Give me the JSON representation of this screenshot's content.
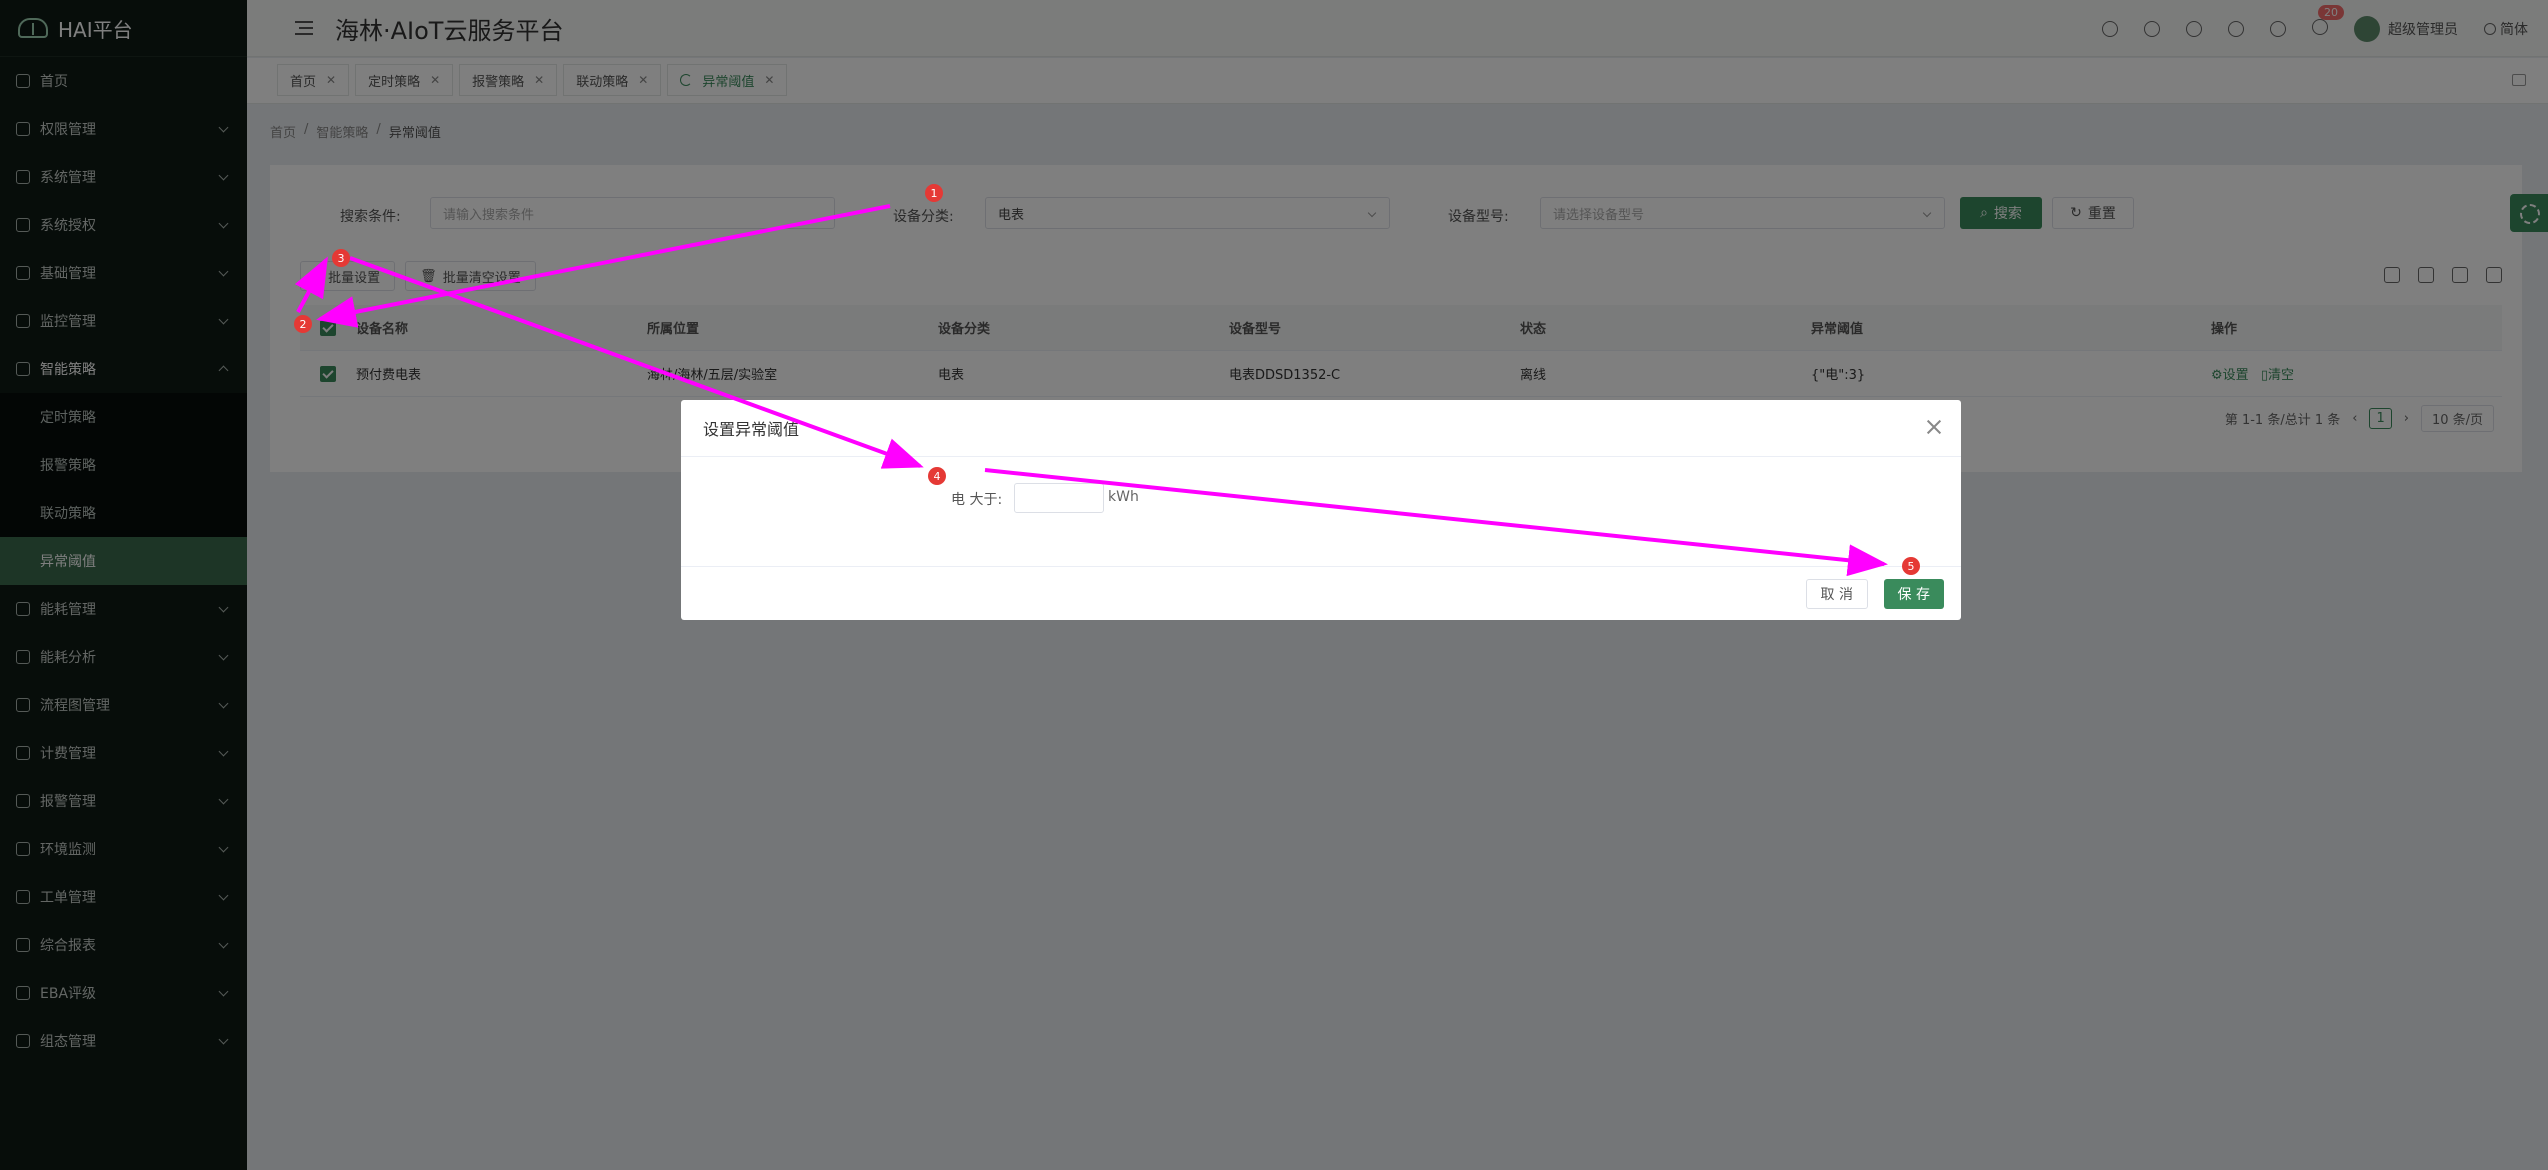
{
  "sidebar": {
    "logo": "HAI平台",
    "items": [
      {
        "label": "首页"
      },
      {
        "label": "权限管理"
      },
      {
        "label": "系统管理"
      },
      {
        "label": "系统授权"
      },
      {
        "label": "基础管理"
      },
      {
        "label": "监控管理"
      },
      {
        "label": "智能策略"
      },
      {
        "label": "能耗管理"
      },
      {
        "label": "能耗分析"
      },
      {
        "label": "流程图管理"
      },
      {
        "label": "计费管理"
      },
      {
        "label": "报警管理"
      },
      {
        "label": "环境监测"
      },
      {
        "label": "工单管理"
      },
      {
        "label": "综合报表"
      },
      {
        "label": "EBA评级"
      },
      {
        "label": "组态管理"
      }
    ],
    "subitems": [
      {
        "label": "定时策略"
      },
      {
        "label": "报警策略"
      },
      {
        "label": "联动策略"
      },
      {
        "label": "异常阈值"
      }
    ]
  },
  "header": {
    "title": "海林·AIoT云服务平台",
    "notify_count": "20",
    "user": "超级管理员",
    "lang": "简体"
  },
  "tabs": [
    {
      "label": "首页"
    },
    {
      "label": "定时策略"
    },
    {
      "label": "报警策略"
    },
    {
      "label": "联动策略"
    },
    {
      "label": "异常阈值"
    }
  ],
  "breadcrumb": {
    "a": "首页",
    "b": "智能策略",
    "c": "异常阈值"
  },
  "search": {
    "cond_label": "搜索条件:",
    "cond_placeholder": "请输入搜索条件",
    "cat_label": "设备分类:",
    "cat_value": "电表",
    "model_label": "设备型号:",
    "model_placeholder": "请选择设备型号",
    "search_btn": "搜索",
    "reset_btn": "重置"
  },
  "toolbar": {
    "batch_set": "批量设置",
    "batch_clear": "批量清空设置"
  },
  "table": {
    "headers": [
      "设备名称",
      "所属位置",
      "设备分类",
      "设备型号",
      "状态",
      "异常阈值",
      "操作"
    ],
    "rows": [
      {
        "name": "预付费电表",
        "location": "海林/海林/五层/实验室",
        "category": "电表",
        "model": "电表DDSD1352-C",
        "status": "离线",
        "threshold": "{\"电\":3}",
        "op_set": "设置",
        "op_clear": "清空"
      }
    ]
  },
  "pager": {
    "summary": "第 1-1 条/总计 1 条",
    "page": "1",
    "size": "10 条/页"
  },
  "dialog": {
    "title": "设置异常阈值",
    "field_label": "电 大于:",
    "unit": "kWh",
    "cancel": "取 消",
    "save": "保 存"
  },
  "markers": [
    "1",
    "2",
    "3",
    "4",
    "5"
  ],
  "colors": {
    "accent": "#3a8b5c",
    "annotation": "#ff00ff",
    "marker": "#e53935"
  }
}
